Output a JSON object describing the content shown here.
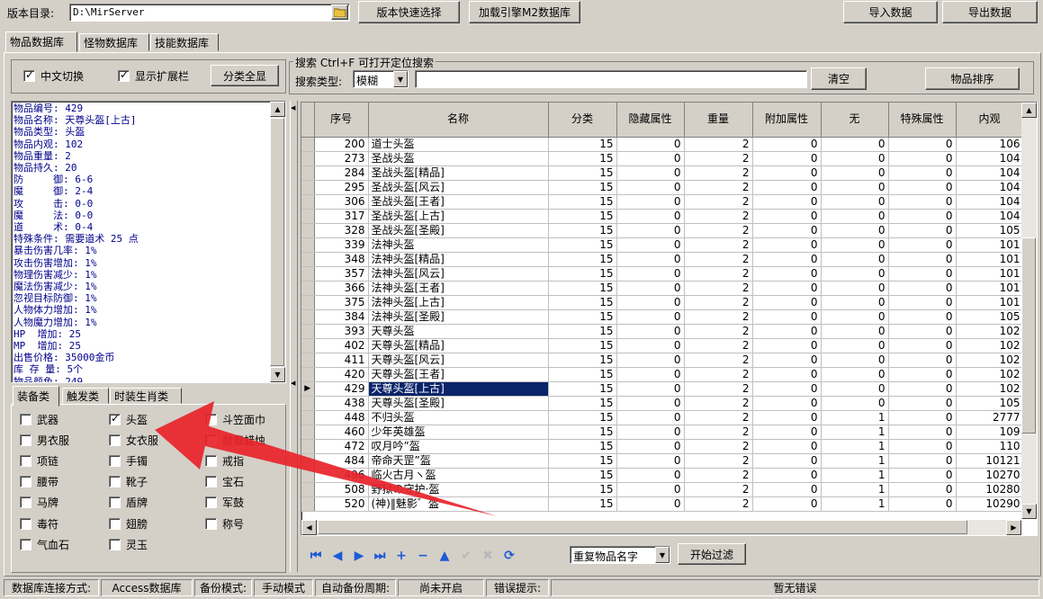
{
  "toolbar": {
    "dir_label": "版本目录:",
    "dir_value": "D:\\MirServer",
    "quick_select": "版本快速选择",
    "load_db": "加载引擎M2数据库",
    "import": "导入数据",
    "export": "导出数据"
  },
  "tabs": [
    "物品数据库",
    "怪物数据库",
    "技能数据库"
  ],
  "options": {
    "cn_switch": "中文切换",
    "show_ext": "显示扩展栏",
    "show_all": "分类全显"
  },
  "search": {
    "group_title": "搜索  Ctrl+F 可打开定位搜索",
    "type_label": "搜索类型:",
    "type_value": "模糊",
    "query": "",
    "clear": "清空",
    "sort": "物品排序"
  },
  "info_text": "物品编号: 429\n物品名称: 天尊头盔[上古]\n物品类型: 头盔\n物品内观: 102\n物品重量: 2\n物品持久: 20\n防     御: 6-6\n魔     御: 2-4\n攻     击: 0-0\n魔     法: 0-0\n道     术: 0-4\n特殊条件: 需要道术 25 点\n暴击伤害几率: 1%\n攻击伤害增加: 1%\n物理伤害减少: 1%\n魔法伤害减少: 1%\n忽视目标防御: 1%\n人物体力增加: 1%\n人物魔力增加: 1%\nHP  增加: 25\nMP  增加: 25\n出售价格: 35000金币\n库 存 量: 5个\n物品颜色: 249",
  "cat_tabs": [
    "装备类",
    "触发类",
    "时装生肖类"
  ],
  "categories": [
    {
      "label": "武器",
      "checked": false
    },
    {
      "label": "头盔",
      "checked": true
    },
    {
      "label": "斗笠面巾",
      "checked": false
    },
    {
      "label": "男衣服",
      "checked": false
    },
    {
      "label": "女衣服",
      "checked": false
    },
    {
      "label": "勋章蜡烛",
      "checked": false
    },
    {
      "label": "项链",
      "checked": false
    },
    {
      "label": "手镯",
      "checked": false
    },
    {
      "label": "戒指",
      "checked": false
    },
    {
      "label": "腰带",
      "checked": false
    },
    {
      "label": "靴子",
      "checked": false
    },
    {
      "label": "宝石",
      "checked": false
    },
    {
      "label": "马牌",
      "checked": false
    },
    {
      "label": "盾牌",
      "checked": false
    },
    {
      "label": "军鼓",
      "checked": false
    },
    {
      "label": "毒符",
      "checked": false
    },
    {
      "label": "翅膀",
      "checked": false
    },
    {
      "label": "称号",
      "checked": false
    },
    {
      "label": "气血石",
      "checked": false
    },
    {
      "label": "灵玉",
      "checked": false
    }
  ],
  "grid": {
    "columns": [
      "序号",
      "名称",
      "分类",
      "隐藏属性",
      "重量",
      "附加属性",
      "无",
      "特殊属性",
      "内观"
    ],
    "rows": [
      [
        "200",
        "道士头盔",
        "15",
        "0",
        "2",
        "0",
        "0",
        "0",
        "106"
      ],
      [
        "273",
        "圣战头盔",
        "15",
        "0",
        "2",
        "0",
        "0",
        "0",
        "104"
      ],
      [
        "284",
        "圣战头盔[精品]",
        "15",
        "0",
        "2",
        "0",
        "0",
        "0",
        "104"
      ],
      [
        "295",
        "圣战头盔[风云]",
        "15",
        "0",
        "2",
        "0",
        "0",
        "0",
        "104"
      ],
      [
        "306",
        "圣战头盔[王者]",
        "15",
        "0",
        "2",
        "0",
        "0",
        "0",
        "104"
      ],
      [
        "317",
        "圣战头盔[上古]",
        "15",
        "0",
        "2",
        "0",
        "0",
        "0",
        "104"
      ],
      [
        "328",
        "圣战头盔[圣殿]",
        "15",
        "0",
        "2",
        "0",
        "0",
        "0",
        "105"
      ],
      [
        "339",
        "法神头盔",
        "15",
        "0",
        "2",
        "0",
        "0",
        "0",
        "101"
      ],
      [
        "348",
        "法神头盔[精品]",
        "15",
        "0",
        "2",
        "0",
        "0",
        "0",
        "101"
      ],
      [
        "357",
        "法神头盔[风云]",
        "15",
        "0",
        "2",
        "0",
        "0",
        "0",
        "101"
      ],
      [
        "366",
        "法神头盔[王者]",
        "15",
        "0",
        "2",
        "0",
        "0",
        "0",
        "101"
      ],
      [
        "375",
        "法神头盔[上古]",
        "15",
        "0",
        "2",
        "0",
        "0",
        "0",
        "101"
      ],
      [
        "384",
        "法神头盔[圣殿]",
        "15",
        "0",
        "2",
        "0",
        "0",
        "0",
        "105"
      ],
      [
        "393",
        "天尊头盔",
        "15",
        "0",
        "2",
        "0",
        "0",
        "0",
        "102"
      ],
      [
        "402",
        "天尊头盔[精品]",
        "15",
        "0",
        "2",
        "0",
        "0",
        "0",
        "102"
      ],
      [
        "411",
        "天尊头盔[风云]",
        "15",
        "0",
        "2",
        "0",
        "0",
        "0",
        "102"
      ],
      [
        "420",
        "天尊头盔[王者]",
        "15",
        "0",
        "2",
        "0",
        "0",
        "0",
        "102"
      ],
      [
        "429",
        "天尊头盔[上古]",
        "15",
        "0",
        "2",
        "0",
        "0",
        "0",
        "102"
      ],
      [
        "438",
        "天尊头盔[圣殿]",
        "15",
        "0",
        "2",
        "0",
        "0",
        "0",
        "105"
      ],
      [
        "448",
        "不归头盔",
        "15",
        "0",
        "2",
        "0",
        "1",
        "0",
        "2777"
      ],
      [
        "460",
        "少年英雄盔",
        "15",
        "0",
        "2",
        "0",
        "1",
        "0",
        "109"
      ],
      [
        "472",
        "叹月吟”盔",
        "15",
        "0",
        "2",
        "0",
        "1",
        "0",
        "110"
      ],
      [
        "484",
        "帝命天罡”盔",
        "15",
        "0",
        "2",
        "0",
        "1",
        "0",
        "10121"
      ],
      [
        "496",
        "临火古月ヽ盔",
        "15",
        "0",
        "2",
        "0",
        "1",
        "0",
        "10270"
      ],
      [
        "508",
        "野狱の守护·盔",
        "15",
        "0",
        "2",
        "0",
        "1",
        "0",
        "10280"
      ],
      [
        "520",
        "(神)‖魅影゛盔",
        "15",
        "0",
        "2",
        "0",
        "1",
        "0",
        "10290"
      ]
    ],
    "selected_index": 17
  },
  "filter": {
    "value": "重复物品名字",
    "start": "开始过滤"
  },
  "status": {
    "conn_label": "数据库连接方式:",
    "conn_value": "Access数据库",
    "backup_label": "备份模式:",
    "backup_value": "手动模式",
    "auto_label": "自动备份周期:",
    "auto_value": "尚未开启",
    "err_label": "错误提示:",
    "err_value": "暂无错误"
  },
  "colors": {
    "selection": "#0a246a",
    "info_text": "#00008b",
    "nav_icons": "#1e5bd6",
    "annotation_arrow": "#e8232a"
  }
}
